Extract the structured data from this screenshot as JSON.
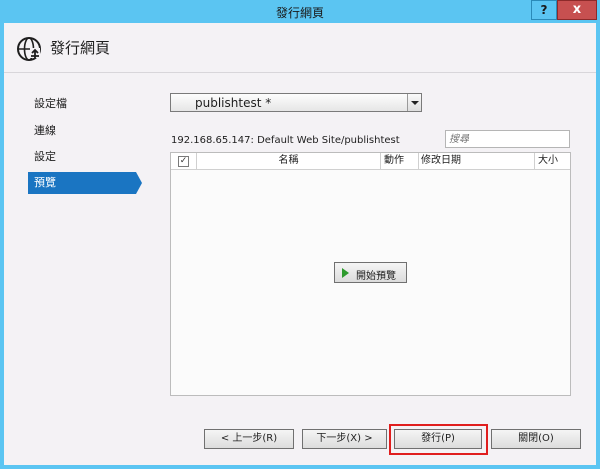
{
  "window": {
    "title": "發行網頁",
    "help_label": "?",
    "close_label": "x"
  },
  "header": {
    "title": "發行網頁"
  },
  "nav": {
    "items": [
      {
        "label": "設定檔"
      },
      {
        "label": "連線"
      },
      {
        "label": "設定"
      },
      {
        "label": "預覽"
      }
    ],
    "active_index": 3
  },
  "profile": {
    "selected": "publishtest *"
  },
  "preview": {
    "site_path": "192.168.65.147: Default Web Site/publishtest",
    "search_placeholder": "搜尋",
    "columns": [
      "名稱",
      "動作",
      "修改日期",
      "大小"
    ],
    "select_all_mark": "✓",
    "start_preview_label": "開始預覽"
  },
  "footer": {
    "prev_label": "< 上一步(R)",
    "next_label": "下一步(X) >",
    "publish_label": "發行(P)",
    "close_label": "關閉(O)"
  },
  "colors": {
    "titlebar": "#5bc5f2",
    "nav_active": "#1a75c2",
    "highlight": "#e01e1e"
  }
}
